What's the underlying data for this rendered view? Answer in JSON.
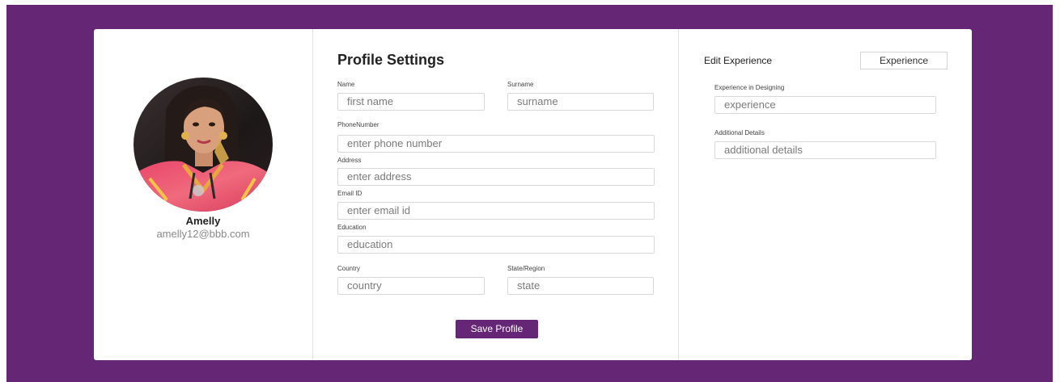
{
  "profile": {
    "name": "Amelly",
    "email": "amelly12@bbb.com"
  },
  "form": {
    "title": "Profile Settings",
    "name_label": "Name",
    "name_placeholder": "first name",
    "surname_label": "Surname",
    "surname_placeholder": "surname",
    "phone_label": "PhoneNumber",
    "phone_placeholder": "enter phone number",
    "address_label": "Address",
    "address_placeholder": "enter address",
    "email_label": "Email ID",
    "email_placeholder": "enter email id",
    "education_label": "Education",
    "education_placeholder": "education",
    "country_label": "Country",
    "country_placeholder": "country",
    "state_label": "State/Region",
    "state_placeholder": "state",
    "save_label": "Save Profile"
  },
  "experience": {
    "heading": "Edit Experience",
    "button_label": "Experience",
    "designing_label": "Experience in Designing",
    "designing_placeholder": "experience",
    "details_label": "Additional Details",
    "details_placeholder": "additional details"
  },
  "colors": {
    "brand": "#652775",
    "background": "#ffffff"
  }
}
